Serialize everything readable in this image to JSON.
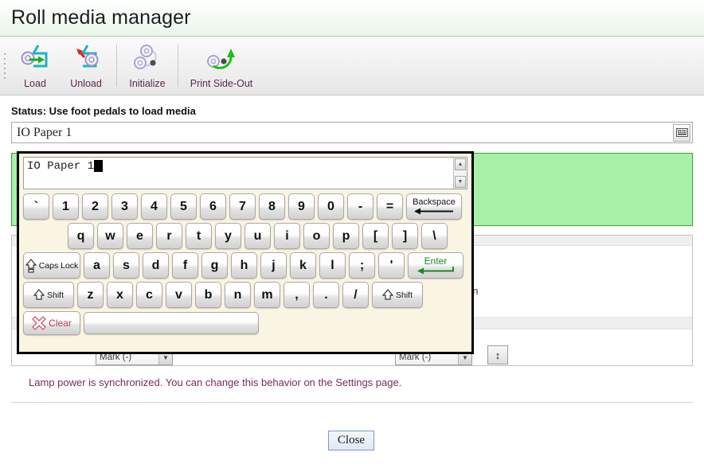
{
  "window": {
    "title": "Roll media manager"
  },
  "toolbar": {
    "grip": "drag-grip",
    "buttons": [
      {
        "label": "Load",
        "icon": "load-roll-icon"
      },
      {
        "label": "Unload",
        "icon": "unload-roll-icon"
      },
      {
        "label": "Initialize",
        "icon": "initialize-roll-icon"
      },
      {
        "label": "Print Side-Out",
        "icon": "print-side-out-icon"
      }
    ]
  },
  "status": {
    "text": "Status: Use foot pedals to load media"
  },
  "media_field": {
    "value": "IO Paper 1",
    "placeholder": "",
    "keyboard_toggle_icon": "keyboard-icon"
  },
  "keyboard": {
    "display_text": "IO Paper 1",
    "caret": "block-caret",
    "scroll_up_icon": "scroll-up-icon",
    "scroll_down_icon": "scroll-down-icon",
    "row1": [
      "`",
      "1",
      "2",
      "3",
      "4",
      "5",
      "6",
      "7",
      "8",
      "9",
      "0",
      "-",
      "="
    ],
    "backspace_label": "Backspace",
    "row2": [
      "q",
      "w",
      "e",
      "r",
      "t",
      "y",
      "u",
      "i",
      "o",
      "p",
      "[",
      "]",
      "\\"
    ],
    "caps_lock_label": "Caps Lock",
    "row3": [
      "a",
      "s",
      "d",
      "f",
      "g",
      "h",
      "j",
      "k",
      "l",
      ";",
      "'"
    ],
    "enter_label": "Enter",
    "shift_label": "Shift",
    "row4": [
      "z",
      "x",
      "c",
      "v",
      "b",
      "n",
      "m",
      ",",
      ".",
      "/"
    ],
    "clear_label": "Clear",
    "space_label": ""
  },
  "background": {
    "green_panel": "",
    "text_fragment": "on",
    "select_left_value": "Mark (-)",
    "select_right_value": "Mark (-)",
    "spinner_value": "",
    "lamp_note": "Lamp power is synchronized. You can change this behavior on the Settings page."
  },
  "footer": {
    "close_label": "Close"
  },
  "colors": {
    "title_bg": "#e9f5ea",
    "green_panel": "#a8f0a8",
    "green_border": "#35a635",
    "keyboard_bg": "#faf4e2",
    "toolbar_label": "#5b2a4e",
    "note_text": "#7a2a5c",
    "enter_green": "#1b8a1b",
    "clear_red": "#c2365a"
  }
}
